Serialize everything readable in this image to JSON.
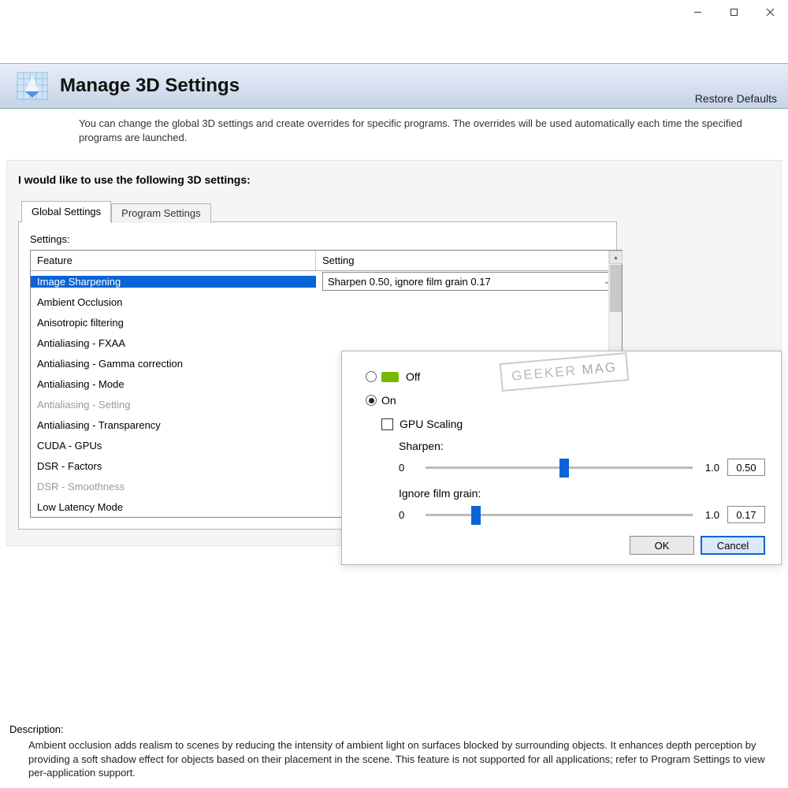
{
  "window": {
    "minimize": "–",
    "maximize": "☐",
    "close": "✕"
  },
  "header": {
    "title": "Manage 3D Settings",
    "restore": "Restore Defaults"
  },
  "intro": "You can change the global 3D settings and create overrides for specific programs. The overrides will be used automatically each time the specified programs are launched.",
  "panel": {
    "title": "I would like to use the following 3D settings:",
    "tabs": {
      "global": "Global Settings",
      "program": "Program Settings"
    },
    "settings_label": "Settings:",
    "columns": {
      "feature": "Feature",
      "setting": "Setting"
    },
    "selected_setting": "Sharpen 0.50, ignore film grain 0.17",
    "features": [
      {
        "name": "Image Sharpening",
        "selected": true
      },
      {
        "name": "Ambient Occlusion"
      },
      {
        "name": "Anisotropic filtering"
      },
      {
        "name": "Antialiasing - FXAA"
      },
      {
        "name": "Antialiasing - Gamma correction"
      },
      {
        "name": "Antialiasing - Mode"
      },
      {
        "name": "Antialiasing - Setting",
        "disabled": true
      },
      {
        "name": "Antialiasing - Transparency"
      },
      {
        "name": "CUDA - GPUs"
      },
      {
        "name": "DSR - Factors"
      },
      {
        "name": "DSR - Smoothness",
        "disabled": true
      },
      {
        "name": "Low Latency Mode"
      }
    ]
  },
  "popup": {
    "off": "Off",
    "on": "On",
    "gpu_scaling": "GPU Scaling",
    "sharpen_label": "Sharpen:",
    "grain_label": "Ignore film grain:",
    "min": "0",
    "max": "1.0",
    "sharpen_value": "0.50",
    "grain_value": "0.17",
    "ok": "OK",
    "cancel": "Cancel"
  },
  "description": {
    "label": "Description:",
    "text": "Ambient occlusion adds realism to scenes by reducing the intensity of ambient light on surfaces blocked by surrounding objects. It enhances depth perception by providing a soft shadow effect for objects based on their placement in the scene. This feature is not supported for all applications; refer to Program Settings to view per-application support."
  },
  "watermark": {
    "a": "GEEKER",
    "b": "MAG"
  }
}
